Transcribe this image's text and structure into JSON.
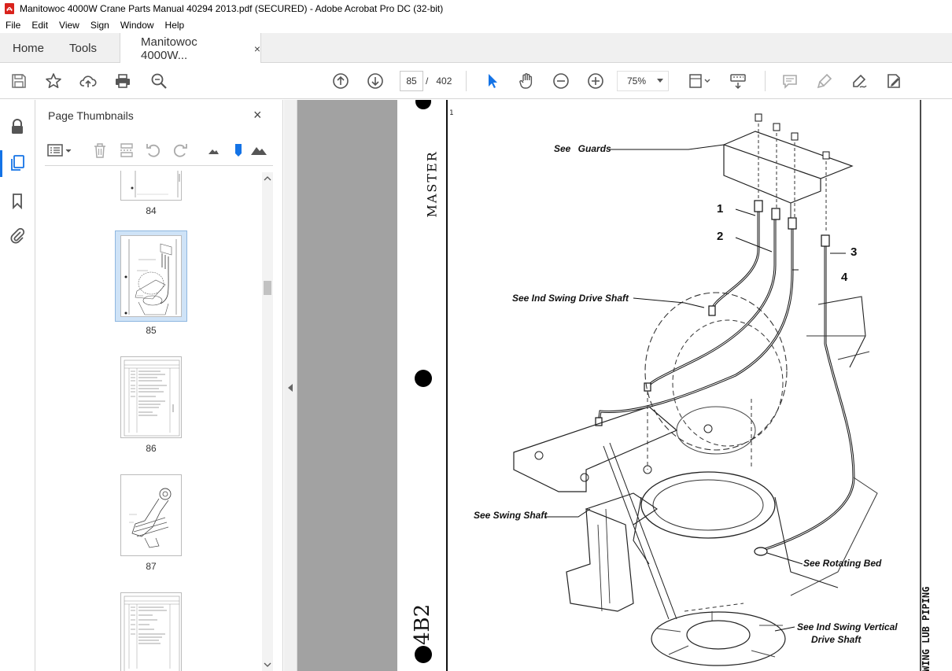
{
  "window": {
    "title": "Manitowoc 4000W Crane Parts Manual 40294 2013.pdf (SECURED) - Adobe Acrobat Pro DC (32-bit)"
  },
  "menu": [
    "File",
    "Edit",
    "View",
    "Sign",
    "Window",
    "Help"
  ],
  "tabs": {
    "home": "Home",
    "tools": "Tools",
    "document": "Manitowoc 4000W...",
    "close": "×"
  },
  "navigation": {
    "current_page": "85",
    "separator": "/",
    "total_pages": "402",
    "zoom": "75%"
  },
  "thumbnails_panel": {
    "title": "Page Thumbnails",
    "close": "×",
    "pages": [
      {
        "label": "84",
        "selected": false
      },
      {
        "label": "85",
        "selected": true
      },
      {
        "label": "86",
        "selected": false
      },
      {
        "label": "87",
        "selected": false
      },
      {
        "label": "",
        "selected": false
      }
    ]
  },
  "document_page": {
    "callouts": {
      "guards": "See Guards",
      "swing_drive_shaft": "See Ind Swing Drive Shaft",
      "swing_shaft": "See Swing Shaft",
      "rotating_bed": "See Rotating Bed",
      "vertical_drive_1": "See Ind Swing Vertical",
      "vertical_drive_2": "Drive Shaft"
    },
    "item_numbers": [
      "1",
      "2",
      "3",
      "4"
    ],
    "margin_stamp": "MASTER",
    "margin_page_code": "4B2",
    "side_title": "WING LUB PIPING",
    "corner_mark": "1"
  },
  "colors": {
    "accent": "#1473e6",
    "viewer_bg": "#a2a2a2",
    "toolbar_icon": "#555555"
  }
}
